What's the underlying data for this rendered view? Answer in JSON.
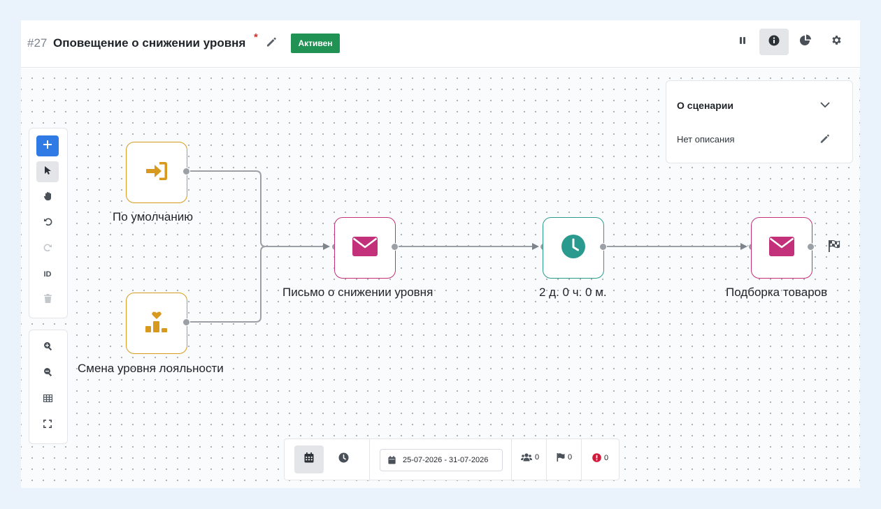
{
  "header": {
    "scenario_id": "#27",
    "title": "Оповещение о снижении уровня",
    "required_mark": "*",
    "status": "Активен",
    "status_color": "#1f9254",
    "actions": [
      "pause-icon",
      "info-icon",
      "chart-pie-icon",
      "gear-icon"
    ]
  },
  "toolbar": {
    "id_label": "ID",
    "tools": [
      "plus-icon",
      "pointer-icon",
      "hand-icon",
      "undo-icon",
      "redo-icon",
      "id-label",
      "trash-icon"
    ],
    "zoom_tools": [
      "zoom-in-icon",
      "zoom-out-icon",
      "grid-icon",
      "fullscreen-icon"
    ],
    "accent_color": "#2f7ae5"
  },
  "about": {
    "title": "О сценарии",
    "description": "Нет описания"
  },
  "nodes": {
    "trigger_default": {
      "label": "По умолчанию",
      "icon": "sign-in-icon"
    },
    "trigger_loyalty": {
      "label": "Смена уровня лояльности",
      "icon": "podium-heart-icon"
    },
    "email_1": {
      "label": "Письмо о снижении уровня",
      "icon": "envelope-icon"
    },
    "delay": {
      "label": "2 д. 0 ч. 0 м.",
      "icon": "clock-icon"
    },
    "email_2": {
      "label": "Подборка товаров",
      "icon": "envelope-icon"
    },
    "finish": {
      "icon": "finish-flag-icon"
    }
  },
  "colors": {
    "trigger": "#d89a1e",
    "email": "#c2317a",
    "delay": "#2a9a8e"
  },
  "bottom_bar": {
    "date_range": "25-07-2026 - 31-07-2026",
    "users_count": "0",
    "goals_count": "0",
    "errors_count": "0"
  }
}
